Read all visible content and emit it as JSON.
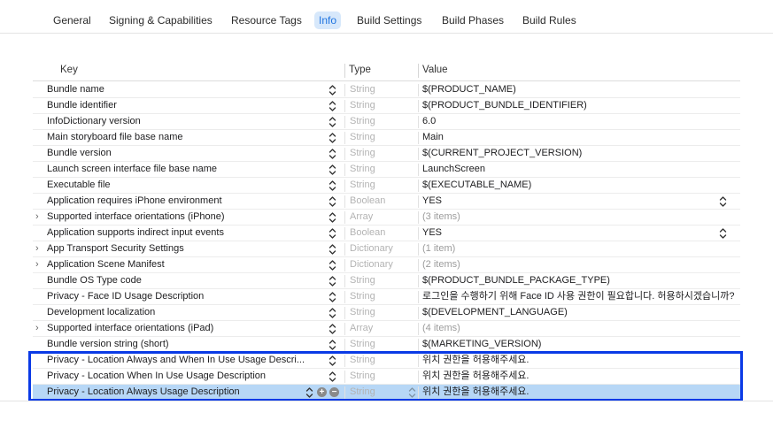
{
  "tabs": [
    {
      "label": "General",
      "active": false
    },
    {
      "label": "Signing & Capabilities",
      "active": false
    },
    {
      "label": "Resource Tags",
      "active": false
    },
    {
      "label": "Info",
      "active": true
    },
    {
      "label": "Build Settings",
      "active": false
    },
    {
      "label": "Build Phases",
      "active": false
    },
    {
      "label": "Build Rules",
      "active": false
    }
  ],
  "table": {
    "headers": {
      "key": "Key",
      "type": "Type",
      "value": "Value"
    },
    "rows": [
      {
        "key": "Bundle name",
        "type": "String",
        "value": "$(PRODUCT_NAME)",
        "expandable": false,
        "value_muted": false,
        "value_stepper": false
      },
      {
        "key": "Bundle identifier",
        "type": "String",
        "value": "$(PRODUCT_BUNDLE_IDENTIFIER)",
        "expandable": false,
        "value_muted": false,
        "value_stepper": false
      },
      {
        "key": "InfoDictionary version",
        "type": "String",
        "value": "6.0",
        "expandable": false,
        "value_muted": false,
        "value_stepper": false
      },
      {
        "key": "Main storyboard file base name",
        "type": "String",
        "value": "Main",
        "expandable": false,
        "value_muted": false,
        "value_stepper": false
      },
      {
        "key": "Bundle version",
        "type": "String",
        "value": "$(CURRENT_PROJECT_VERSION)",
        "expandable": false,
        "value_muted": false,
        "value_stepper": false
      },
      {
        "key": "Launch screen interface file base name",
        "type": "String",
        "value": "LaunchScreen",
        "expandable": false,
        "value_muted": false,
        "value_stepper": false
      },
      {
        "key": "Executable file",
        "type": "String",
        "value": "$(EXECUTABLE_NAME)",
        "expandable": false,
        "value_muted": false,
        "value_stepper": false
      },
      {
        "key": "Application requires iPhone environment",
        "type": "Boolean",
        "value": "YES",
        "expandable": false,
        "value_muted": false,
        "value_stepper": true
      },
      {
        "key": "Supported interface orientations (iPhone)",
        "type": "Array",
        "value": "(3 items)",
        "expandable": true,
        "value_muted": true,
        "value_stepper": false
      },
      {
        "key": "Application supports indirect input events",
        "type": "Boolean",
        "value": "YES",
        "expandable": false,
        "value_muted": false,
        "value_stepper": true
      },
      {
        "key": "App Transport Security Settings",
        "type": "Dictionary",
        "value": "(1 item)",
        "expandable": true,
        "value_muted": true,
        "value_stepper": false
      },
      {
        "key": "Application Scene Manifest",
        "type": "Dictionary",
        "value": "(2 items)",
        "expandable": true,
        "value_muted": true,
        "value_stepper": false
      },
      {
        "key": "Bundle OS Type code",
        "type": "String",
        "value": "$(PRODUCT_BUNDLE_PACKAGE_TYPE)",
        "expandable": false,
        "value_muted": false,
        "value_stepper": false
      },
      {
        "key": "Privacy - Face ID Usage Description",
        "type": "String",
        "value": "로그인을 수행하기 위해 Face ID 사용 권한이 필요합니다. 허용하시겠습니까?",
        "expandable": false,
        "value_muted": false,
        "value_stepper": false
      },
      {
        "key": "Development localization",
        "type": "String",
        "value": "$(DEVELOPMENT_LANGUAGE)",
        "expandable": false,
        "value_muted": false,
        "value_stepper": false
      },
      {
        "key": "Supported interface orientations (iPad)",
        "type": "Array",
        "value": "(4 items)",
        "expandable": true,
        "value_muted": true,
        "value_stepper": false
      },
      {
        "key": "Bundle version string (short)",
        "type": "String",
        "value": "$(MARKETING_VERSION)",
        "expandable": false,
        "value_muted": false,
        "value_stepper": false
      },
      {
        "key": "Privacy - Location Always and When In Use Usage Descri...",
        "type": "String",
        "value": "위치 권한을 허용해주세요.",
        "expandable": false,
        "value_muted": false,
        "value_stepper": false
      },
      {
        "key": "Privacy - Location When In Use Usage Description",
        "type": "String",
        "value": "위치 권한을 허용해주세요.",
        "expandable": false,
        "value_muted": false,
        "value_stepper": false
      },
      {
        "key": "Privacy - Location Always Usage Description",
        "type": "String",
        "value": "위치 권한을 허용해주세요.",
        "expandable": false,
        "value_muted": false,
        "value_stepper": false,
        "selected": true
      }
    ]
  },
  "colors": {
    "accent": "#1f74e0",
    "active_tab_bg": "#d7e8fb",
    "selected_row_bg": "#b7d7f6",
    "highlight_border": "#0a3ae6"
  },
  "icons": {
    "disclosure": "chevron-right-icon",
    "stepper": "up-down-stepper-icon",
    "add": "plus-circle-icon",
    "remove": "minus-circle-icon"
  }
}
